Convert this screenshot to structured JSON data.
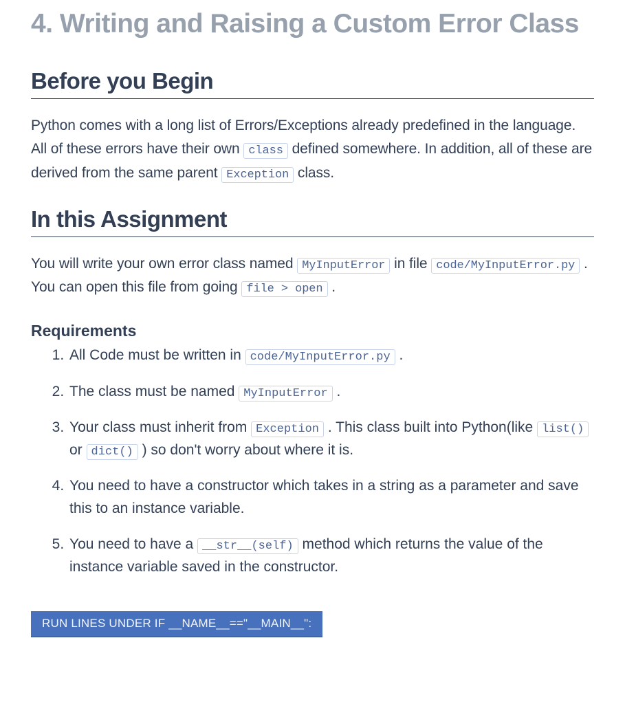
{
  "title": "4. Writing and Raising a Custom Error Class",
  "sections": {
    "before_heading": "Before you Begin",
    "before_p1a": "Python comes with a long list of Errors/Exceptions already predefined in the language. All of these errors have their own ",
    "before_code1": "class",
    "before_p1b": " defined somewhere. In addition, all of these are derived from the same parent ",
    "before_code2": "Exception",
    "before_p1c": " class.",
    "assign_heading": "In this Assignment",
    "assign_p1a": "You will write your own error class named ",
    "assign_code1": "MyInputError",
    "assign_p1b": " in file ",
    "assign_code2": "code/MyInputError.py",
    "assign_p1c": ". You can open this file from going ",
    "assign_code3": "file > open",
    "assign_p1d": ".",
    "req_heading": "Requirements",
    "req1a": "All Code must be written in ",
    "req1code": "code/MyInputError.py",
    "req1b": ".",
    "req2a": "The class must be named ",
    "req2code": "MyInputError",
    "req2b": ".",
    "req3a": "Your class must inherit from ",
    "req3code1": "Exception",
    "req3b": ". This class built into Python(like ",
    "req3code2": "list()",
    "req3c": " or ",
    "req3code3": "dict()",
    "req3d": ") so don't worry about where it is.",
    "req4": "You need to have a constructor which takes in a string as a parameter and save this to an instance variable.",
    "req5a": "You need to have a ",
    "req5code": "__str__(self)",
    "req5b": " method which returns the value of the instance variable saved in the constructor."
  },
  "run_cell_label": "RUN LINES UNDER IF __NAME__==\"__MAIN__\":"
}
